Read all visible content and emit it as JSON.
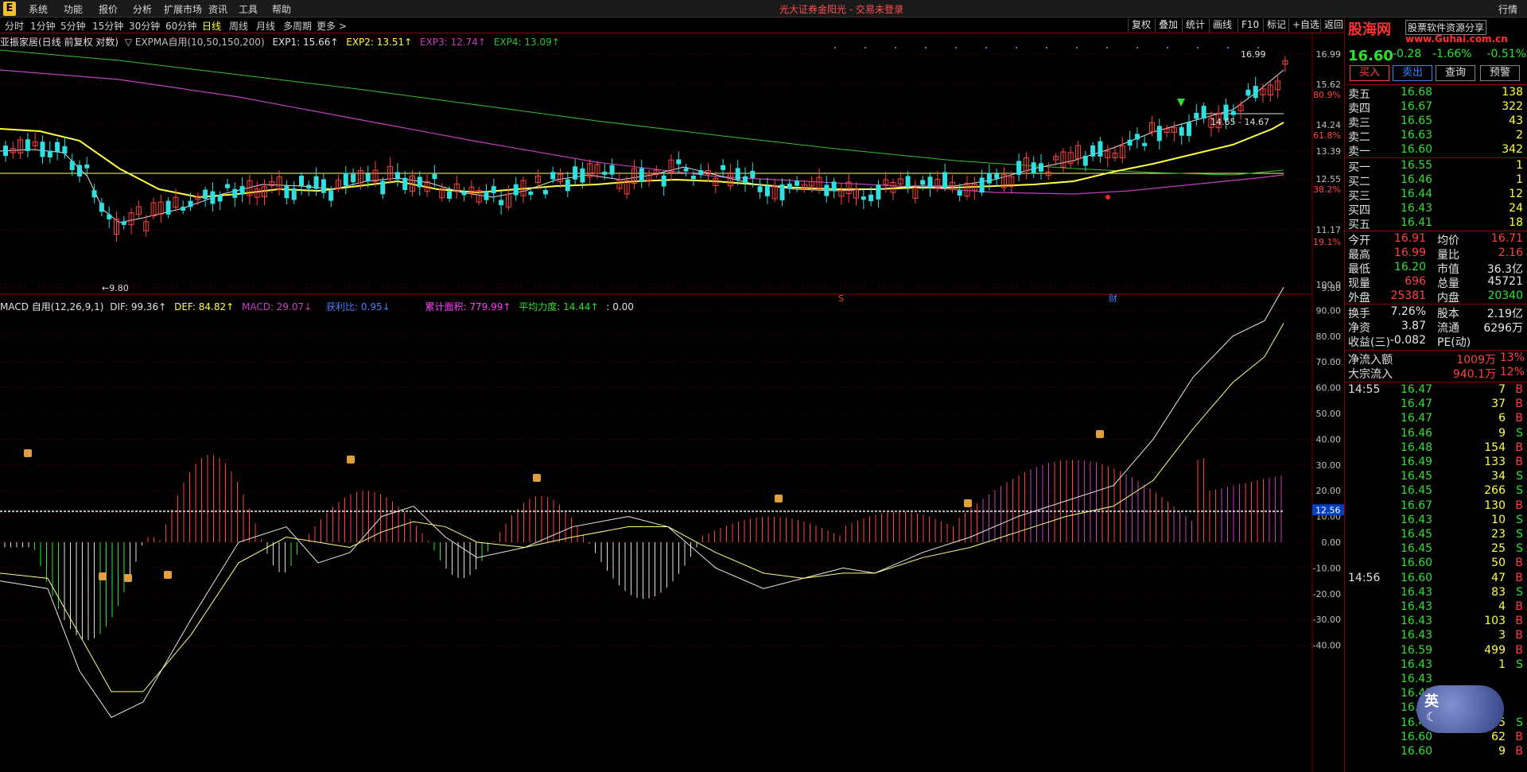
{
  "menu": {
    "logo": "E",
    "items": [
      "系统",
      "功能",
      "报价",
      "分析",
      "扩展市场",
      "资讯",
      "工具",
      "帮助"
    ],
    "title": "光大证券金阳光 - 交易未登录",
    "right": "行情"
  },
  "toolbar": {
    "timeframes": [
      "分时",
      "1分钟",
      "5分钟",
      "15分钟",
      "30分钟",
      "60分钟",
      "日线",
      "周线",
      "月线",
      "多周期",
      "更多 >"
    ],
    "active_index": 6,
    "buttons": [
      "复权",
      "叠加",
      "统计",
      "画线",
      "F10",
      "标记",
      "+自选",
      "返回"
    ]
  },
  "info_line": {
    "stock": "亚振家居(日线 前复权 对数)",
    "indicator": "▽ EXPMA自用(10,50,150,200)",
    "exp1": "EXP1: 15.66↑",
    "exp2": "EXP2: 13.51↑",
    "exp3": "EXP3: 12.74↑",
    "exp4": "EXP4: 13.09↑"
  },
  "macd_line": {
    "name": "MACD 自用(12,26,9,1)",
    "dif": "DIF: 99.36↑",
    "def": "DEF: 84.82↑",
    "macd": "MACD: 29.07↓",
    "hl": "获利比: 0.95↓",
    "area": "累计面积: 779.99↑",
    "avg": "平均力度: 14.44↑",
    "zero": ": 0.00"
  },
  "price_axis": [
    "16.99",
    "15.62",
    "80.9%",
    "14.24",
    "61.8%",
    "13.39",
    "12.55",
    "38.2%",
    "11.17",
    "19.1%",
    "9.80"
  ],
  "macd_axis": [
    "100.0",
    "90.00",
    "80.00",
    "70.00",
    "60.00",
    "50.00",
    "40.00",
    "30.00",
    "20.00",
    "10.00",
    "0.00",
    "-10.00",
    "-20.00",
    "-30.00",
    "-40.00"
  ],
  "chart_labels": {
    "high": "16.99",
    "low": "9.80",
    "range": "14.65 - 14.67",
    "cur_macd": "12.56",
    "s_mark": "S",
    "cai_mark": "财"
  },
  "colors": {
    "up": "#ff4040",
    "down": "#30e0e0",
    "exp1": "#e0e0e0",
    "exp2": "#ffff40",
    "exp3": "#c040c0",
    "exp4": "#30c030"
  },
  "quote": {
    "price": "16.60",
    "change": "-0.28",
    "pct": "-1.66%",
    "index_pct": "-0.51%",
    "brand": "股海网",
    "brand_sub": "股票软件资源分享",
    "brand_url": "www.Guhai.com.cn",
    "buttons": [
      "买入",
      "卖出",
      "查询",
      "预警"
    ],
    "asks": [
      {
        "label": "卖五",
        "price": "16.68",
        "vol": "138"
      },
      {
        "label": "卖四",
        "price": "16.67",
        "vol": "322"
      },
      {
        "label": "卖三",
        "price": "16.65",
        "vol": "43"
      },
      {
        "label": "卖二",
        "price": "16.63",
        "vol": "2"
      },
      {
        "label": "卖一",
        "price": "16.60",
        "vol": "342"
      }
    ],
    "bids": [
      {
        "label": "买一",
        "price": "16.55",
        "vol": "1"
      },
      {
        "label": "买二",
        "price": "16.46",
        "vol": "1"
      },
      {
        "label": "买三",
        "price": "16.44",
        "vol": "12"
      },
      {
        "label": "买四",
        "price": "16.43",
        "vol": "24"
      },
      {
        "label": "买五",
        "price": "16.41",
        "vol": "18"
      }
    ],
    "stats": [
      {
        "l1": "今开",
        "v1": "16.91",
        "c1": "up",
        "l2": "均价",
        "v2": "16.71",
        "c2": "up"
      },
      {
        "l1": "最高",
        "v1": "16.99",
        "c1": "up",
        "l2": "量比",
        "v2": "2.16",
        "c2": "up"
      },
      {
        "l1": "最低",
        "v1": "16.20",
        "c1": "dn",
        "l2": "市值",
        "v2": "36.3亿",
        "c2": "wh"
      },
      {
        "l1": "现量",
        "v1": "696",
        "c1": "up",
        "l2": "总量",
        "v2": "45721",
        "c2": "wh"
      },
      {
        "l1": "外盘",
        "v1": "25381",
        "c1": "up",
        "l2": "内盘",
        "v2": "20340",
        "c2": "dn"
      }
    ],
    "stats2": [
      {
        "l1": "换手",
        "v1": "7.26%",
        "c1": "wh",
        "l2": "股本",
        "v2": "2.19亿",
        "c2": "wh"
      },
      {
        "l1": "净资",
        "v1": "3.87",
        "c1": "wh",
        "l2": "流通",
        "v2": "6296万",
        "c2": "wh"
      },
      {
        "l1": "收益(三)",
        "v1": "-0.082",
        "c1": "wh",
        "l2": "PE(动)",
        "v2": "",
        "c2": "wh"
      }
    ],
    "flows": [
      {
        "label": "净流入额",
        "value": "1009万",
        "pct": "13%"
      },
      {
        "label": "大宗流入",
        "value": "940.1万",
        "pct": "12%"
      }
    ],
    "ticks": [
      {
        "t": "14:55",
        "p": "16.47",
        "v": "7",
        "s": "B"
      },
      {
        "t": "",
        "p": "16.47",
        "v": "37",
        "s": "B"
      },
      {
        "t": "",
        "p": "16.47",
        "v": "6",
        "s": "B"
      },
      {
        "t": "",
        "p": "16.46",
        "v": "9",
        "s": "S"
      },
      {
        "t": "",
        "p": "16.48",
        "v": "154",
        "s": "B"
      },
      {
        "t": "",
        "p": "16.49",
        "v": "133",
        "s": "B"
      },
      {
        "t": "",
        "p": "16.45",
        "v": "34",
        "s": "S"
      },
      {
        "t": "",
        "p": "16.45",
        "v": "266",
        "s": "S"
      },
      {
        "t": "",
        "p": "16.67",
        "v": "130",
        "s": "B"
      },
      {
        "t": "",
        "p": "16.43",
        "v": "10",
        "s": "S"
      },
      {
        "t": "",
        "p": "16.45",
        "v": "23",
        "s": "S"
      },
      {
        "t": "",
        "p": "16.45",
        "v": "25",
        "s": "S"
      },
      {
        "t": "",
        "p": "16.60",
        "v": "50",
        "s": "B"
      },
      {
        "t": "14:56",
        "p": "16.60",
        "v": "47",
        "s": "B"
      },
      {
        "t": "",
        "p": "16.43",
        "v": "83",
        "s": "S"
      },
      {
        "t": "",
        "p": "16.43",
        "v": "4",
        "s": "B"
      },
      {
        "t": "",
        "p": "16.43",
        "v": "103",
        "s": "B"
      },
      {
        "t": "",
        "p": "16.43",
        "v": "3",
        "s": "B"
      },
      {
        "t": "",
        "p": "16.59",
        "v": "499",
        "s": "B"
      },
      {
        "t": "",
        "p": "16.43",
        "v": "1",
        "s": "S"
      },
      {
        "t": "",
        "p": "16.43",
        "v": "",
        "s": ""
      },
      {
        "t": "",
        "p": "16.43",
        "v": "",
        "s": ""
      },
      {
        "t": "",
        "p": "16.43",
        "v": "",
        "s": ""
      },
      {
        "t": "",
        "p": "16.44",
        "v": "125",
        "s": "S"
      },
      {
        "t": "",
        "p": "16.60",
        "v": "62",
        "s": "B"
      },
      {
        "t": "",
        "p": "16.60",
        "v": "9",
        "s": "B"
      }
    ],
    "ime": "英"
  }
}
